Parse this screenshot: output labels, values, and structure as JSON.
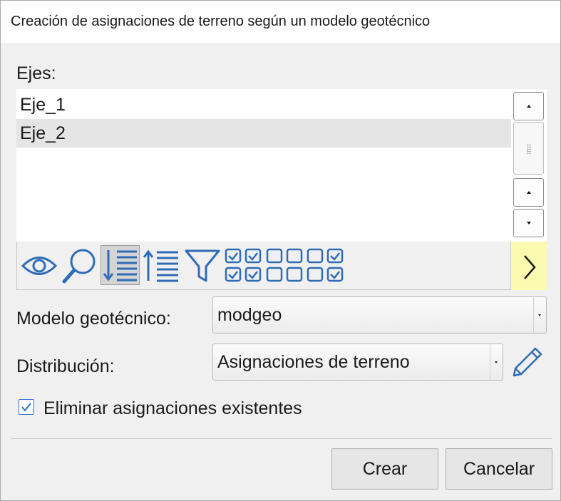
{
  "window": {
    "title": "Creación de asignaciones de terreno según un modelo geotécnico"
  },
  "axes": {
    "label": "Ejes:",
    "items": [
      "Eje_1",
      "Eje_2"
    ],
    "selected": "Eje_2"
  },
  "toolbar": {
    "icons": [
      "eye-icon",
      "magnifier-icon",
      "sort-descending-icon",
      "sort-ascending-icon",
      "filter-icon",
      "check-all-icon",
      "uncheck-all-icon",
      "invert-check-icon"
    ],
    "next_icon": "chevron-right-icon",
    "accent": "#2f6cb5",
    "next_bg": "#fafab0"
  },
  "model": {
    "label": "Modelo geotécnico:",
    "value": "modgeo"
  },
  "distribution": {
    "label": "Distribución:",
    "value": "Asignaciones de terreno"
  },
  "delete_existing": {
    "label": "Eliminar asignaciones existentes",
    "checked": true
  },
  "buttons": {
    "create": "Crear",
    "cancel": "Cancelar"
  }
}
